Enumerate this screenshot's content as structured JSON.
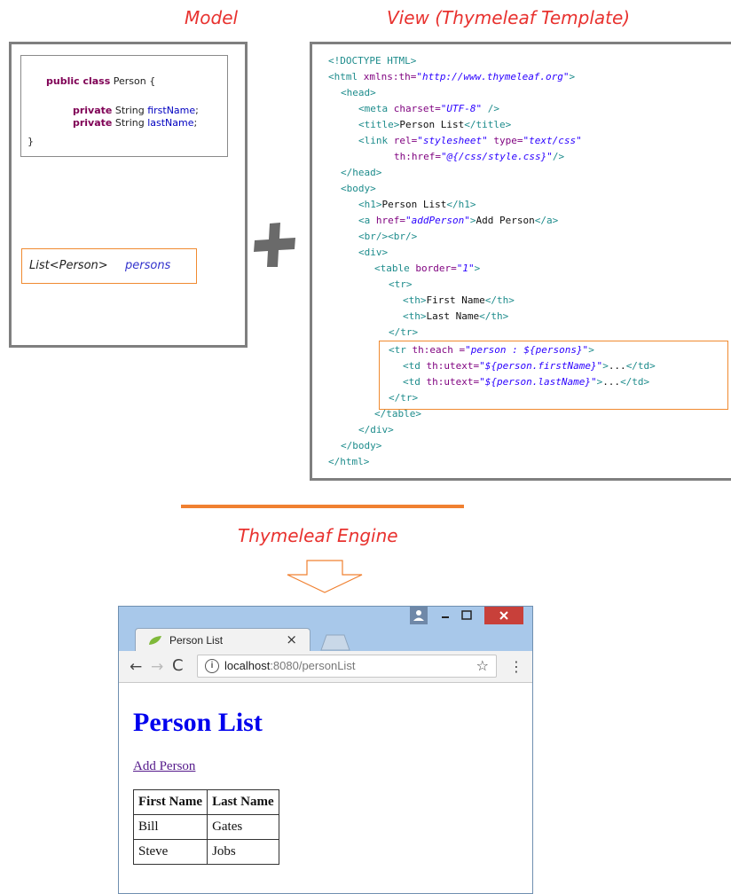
{
  "headings": {
    "model": "Model",
    "view": "View (Thymeleaf Template)",
    "engine": "Thymeleaf Engine"
  },
  "model": {
    "class_lines": [
      "public class Person {",
      "private String firstName;",
      "private String lastName;",
      "}"
    ],
    "persons_type": "List<Person>",
    "persons_name": "persons"
  },
  "template_lines": [
    "<!DOCTYPE HTML>",
    "<html xmlns:th=\"http://www.thymeleaf.org\">",
    "  <head>",
    "    <meta charset=\"UTF-8\" />",
    "    <title>Person List</title>",
    "    <link rel=\"stylesheet\" type=\"text/css\"",
    "        th:href=\"@{/css/style.css}\"/>",
    "  </head>",
    "  <body>",
    "    <h1>Person List</h1>",
    "    <a href=\"addPerson\">Add Person</a>",
    "    <br/><br/>",
    "    <div>",
    "      <table border=\"1\">",
    "        <tr>",
    "          <th>First Name</th>",
    "          <th>Last Name</th>",
    "        </tr>",
    "        <tr th:each =\"person : ${persons}\">",
    "          <td th:utext=\"${person.firstName}\">...</td>",
    "          <td th:utext=\"${person.lastName}\">...</td>",
    "        </tr>",
    "      </table>",
    "    </div>",
    "  </body>",
    "</html>"
  ],
  "browser": {
    "tab_title": "Person List",
    "url_host": "localhost",
    "url_rest": ":8080/personList",
    "page_title": "Person List",
    "add_link": "Add Person",
    "table": {
      "headers": [
        "First Name",
        "Last Name"
      ],
      "rows": [
        [
          "Bill",
          "Gates"
        ],
        [
          "Steve",
          "Jobs"
        ]
      ]
    }
  },
  "colors": {
    "accent_orange": "#f08030",
    "heading_red": "#e8322f",
    "frame_gray": "#7f7f7f"
  }
}
